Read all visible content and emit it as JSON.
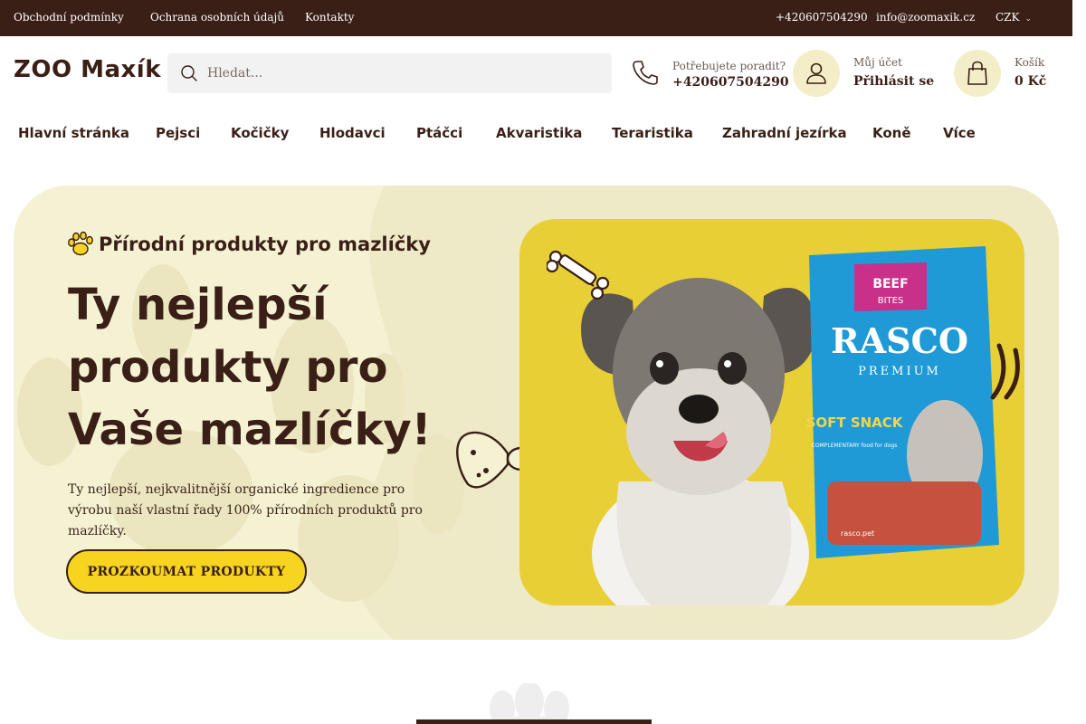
{
  "topbar": {
    "links": [
      "Obchodní podmínky",
      "Ochrana osobních údajů",
      "Kontakty"
    ],
    "phone": "+420607504290",
    "email": "info@zoomaxik.cz",
    "currency": "CZK"
  },
  "header": {
    "logo": "ZOO Maxík",
    "search_placeholder": "Hledat...",
    "help_label": "Potřebujete poradit?",
    "help_phone": "+420607504290",
    "account_label": "Můj účet",
    "account_action": "Přihlásit se",
    "cart_label": "Košík",
    "cart_total": "0 Kč"
  },
  "nav": {
    "items": [
      "Hlavní stránka",
      "Pejsci",
      "Kočičky",
      "Hlodavci",
      "Ptáčci",
      "Akvaristika",
      "Teraristika",
      "Zahradní jezírka",
      "Koně",
      "Více"
    ]
  },
  "hero": {
    "kicker": "Přírodní produkty pro mazlíčky",
    "headline": "Ty nejlepší produkty pro Vaše mazlíčky!",
    "description": "Ty nejlepší, nejkvalitnější organické ingredience pro výrobu naší vlastní řady 100% přírodních produktů pro mazlíčky.",
    "cta": "PROZKOUMAT PRODUKTY",
    "pack": {
      "badge": "BEEF",
      "badge_sub": "BITES",
      "brand": "RASCO",
      "line": "PREMIUM",
      "product": "SOFT SNACK",
      "subtitle": "COMPLEMENTARY food for dogs",
      "site": "rasco.pet"
    }
  },
  "colors": {
    "brand_dark": "#3a1f17",
    "accent_yellow": "#f6d41f",
    "hero_bg": "#f5f2d4",
    "promo_bg": "#e8cf36",
    "pack_blue": "#1f9ad6",
    "pack_pink": "#c8308a"
  }
}
